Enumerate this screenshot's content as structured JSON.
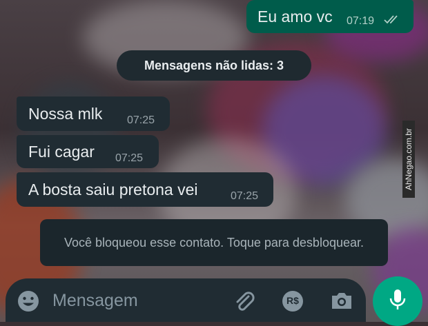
{
  "messages": [
    {
      "direction": "outgoing",
      "text": "Eu amo vc",
      "time": "07:19",
      "status": "read"
    },
    {
      "direction": "incoming",
      "text": "Nossa mlk",
      "time": "07:25"
    },
    {
      "direction": "incoming",
      "text": "Fui cagar",
      "time": "07:25"
    },
    {
      "direction": "incoming",
      "text": "A bosta saiu pretona vei",
      "time": "07:25"
    }
  ],
  "unread_label": "Mensagens não lidas: 3",
  "blocked_notice": "Você bloqueou esse contato. Toque para desbloquear.",
  "watermark": "AhNegao.com.br",
  "composer": {
    "placeholder": "Mensagem",
    "icons": [
      "emoji-icon",
      "attach-icon",
      "payment-icon",
      "camera-icon",
      "mic-icon"
    ],
    "payment_label": "R$"
  },
  "colors": {
    "outgoing_bubble": "#005c4b",
    "incoming_bubble": "#202c33",
    "accent": "#00a884"
  }
}
